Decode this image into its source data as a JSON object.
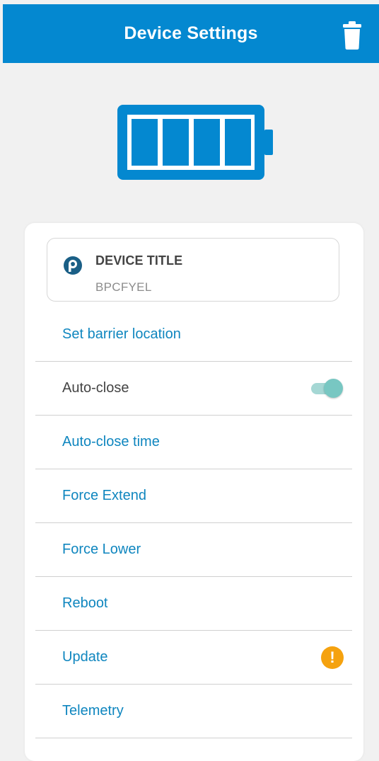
{
  "header": {
    "title": "Device Settings",
    "delete_icon": "trash-icon",
    "background_color": "#0488d0"
  },
  "battery": {
    "icon": "battery-full-icon",
    "level_fraction": 1.0,
    "color": "#0488d0"
  },
  "device": {
    "title_label": "DEVICE TITLE",
    "code": "BPCFYEL",
    "logo_icon": "device-logo-icon"
  },
  "menu": {
    "items": [
      {
        "label": "Set barrier location"
      },
      {
        "label": "Auto-close",
        "toggle_on": true
      },
      {
        "label": "Auto-close time"
      },
      {
        "label": "Force Extend"
      },
      {
        "label": "Force Lower"
      },
      {
        "label": "Reboot"
      },
      {
        "label": "Update",
        "badge_icon": "warning-icon",
        "badge_text": "!"
      },
      {
        "label": "Telemetry"
      }
    ]
  },
  "colors": {
    "link": "#0f86bf",
    "toggle_accent": "#78c7c2",
    "warning": "#f5a20f"
  }
}
